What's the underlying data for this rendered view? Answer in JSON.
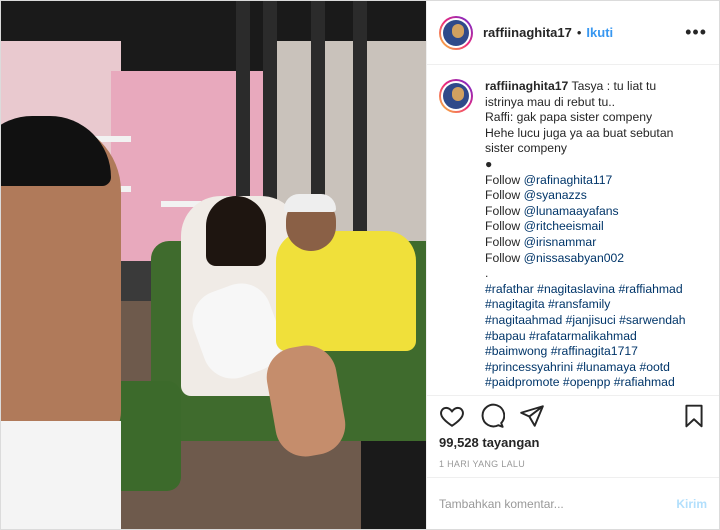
{
  "post": {
    "username": "raffiinaghita17",
    "separator": "•",
    "follow_label": "Ikuti",
    "more_label": "•••"
  },
  "caption": {
    "username": "raffiinaghita17",
    "lines": [
      "Tasya : tu liat tu",
      "istrinya mau di rebut tu..",
      "Raffi: gak papa sister compeny",
      "Hehe lucu juga ya aa buat sebutan",
      "sister compeny",
      "●"
    ],
    "follow_prefix": "Follow ",
    "mentions": [
      "@rafinaghita117",
      "@syanazzs",
      "@lunamaayafans",
      "@ritcheeismail",
      "@irisnammar",
      "@nissasabyan002"
    ],
    "dot_line": ".",
    "hashtag_lines": [
      "#rafathar #nagitaslavina #raffiahmad",
      "#nagitagita #ransfamily",
      "#nagitaahmad #janjisuci #sarwendah",
      "#bapau #rafatarmalikahmad",
      "#baimwong #raffinagita1717",
      "#princessyahrini #lunamaya #ootd",
      "#paidpromote #openpp #rafiahmad"
    ]
  },
  "stats": {
    "views": "99,528 tayangan",
    "time": "1 HARI YANG LALU"
  },
  "comment_box": {
    "placeholder": "Tambahkan komentar...",
    "post_label": "Kirim"
  },
  "icons": {
    "like": "heart-icon",
    "comment": "comment-icon",
    "share": "share-icon",
    "save": "bookmark-icon"
  },
  "colors": {
    "link": "#3897f0",
    "post_disabled": "#b2dffc",
    "muted": "#999999"
  }
}
